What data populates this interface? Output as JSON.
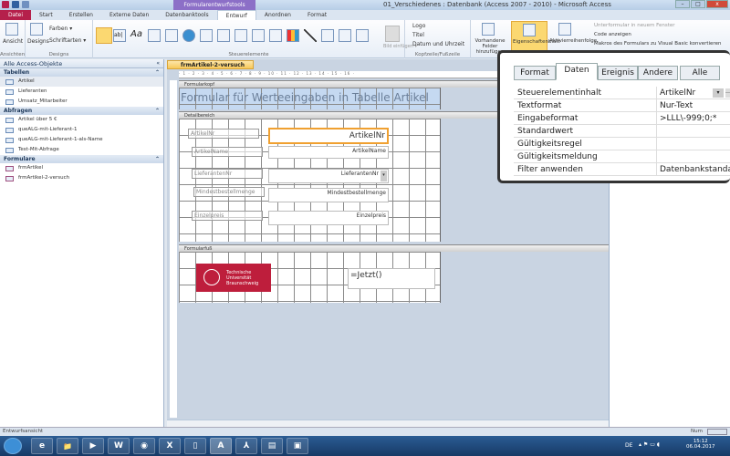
{
  "titlebar": {
    "title": "01_Verschiedenes : Datenbank (Access 2007 - 2010) - Microsoft Access",
    "context_tab": "Formularentwurfstools",
    "minimize": "–",
    "maximize": "□",
    "close": "x"
  },
  "tabs": [
    "Datei",
    "Start",
    "Erstellen",
    "Externe Daten",
    "Datenbanktools",
    "Entwurf",
    "Anordnen",
    "Format"
  ],
  "ribbon": {
    "ansichten": {
      "button": "Ansicht",
      "group": "Ansichten"
    },
    "designs": {
      "button": "Designs",
      "farben": "Farben ▾",
      "schriftarten": "Schriftarten ▾",
      "group": "Designs"
    },
    "steuerelemente": {
      "group": "Steuerelemente",
      "textbox": "ab|",
      "label": "Aa"
    },
    "bild": {
      "label": "Bild einfügen ▾"
    },
    "kopf": {
      "logo": "Logo",
      "titel": "Titel",
      "datum": "Datum und Uhrzeit",
      "group": "Kopfzeile/Fußzeile"
    },
    "tools": {
      "vorhandene": "Vorhandene Felder hinzufügen",
      "eigenschaften": "Eigenschaftenblatt",
      "aktivierung": "Aktivierreihenfolge",
      "unterformular": "Unterformular in neuem Fenster",
      "code": "Code anzeigen",
      "makros": "Makros des Formulars zu Visual Basic konvertieren"
    }
  },
  "nav": {
    "title": "Alle Access-Objekte",
    "sections": [
      {
        "name": "Tabellen",
        "items": [
          "Artikel",
          "Lieferanten",
          "Umsatz_Mitarbeiter"
        ]
      },
      {
        "name": "Abfragen",
        "items": [
          "Artikel über 5 €",
          "queALG-mit-Lieferant-1",
          "queALG-mit-Lieferant-1-als-Name",
          "Test-Mit-Abfrage"
        ]
      },
      {
        "name": "Formulare",
        "items": [
          "frmArtikel",
          "frmArtikel-2-versuch"
        ]
      }
    ]
  },
  "document": {
    "tab": "frmArtikel-2-versuch",
    "ruler": "· 1 · 2 · 3 · 4 · 5 · 6 · 7 · 8 · 9 · 10 · 11 · 12 · 13 · 14 · 15 · 16 ·",
    "header_section": "Formularkopf",
    "header_title": "Formular für Werteeingaben in Tabelle Artikel",
    "detail_section": "Detailbereich",
    "fields": [
      {
        "label": "ArtikelNr",
        "control": "ArtikelNr"
      },
      {
        "label": "ArtikelName",
        "control": "ArtikelName"
      },
      {
        "label": "LieferantenNr",
        "control": "LieferantenNr"
      },
      {
        "label": "Mindestbestellmenge",
        "control": "Mindestbestellmenge"
      },
      {
        "label": "Einzelpreis",
        "control": "Einzelpreis"
      }
    ],
    "footer_section": "Formularfuß",
    "logo_text": [
      "Technische",
      "Universität",
      "Braunschweig"
    ],
    "footer_control": "=Jetzt()"
  },
  "properties": {
    "tabs": [
      "Format",
      "Daten",
      "Ereignis",
      "Andere",
      "Alle"
    ],
    "active_tab": "Daten",
    "rows": [
      {
        "key": "Steuerelementinhalt",
        "value": "ArtikelNr"
      },
      {
        "key": "Textformat",
        "value": "Nur-Text"
      },
      {
        "key": "Eingabeformat",
        "value": ">LLL\\-999;0;*"
      },
      {
        "key": "Standardwert",
        "value": ""
      },
      {
        "key": "Gültigkeitsregel",
        "value": ""
      },
      {
        "key": "Gültigkeitsmeldung",
        "value": ""
      },
      {
        "key": "Filter anwenden",
        "value": "Datenbankstandard"
      }
    ]
  },
  "status": {
    "text": "Entwurfsansicht",
    "num": "Num"
  },
  "taskbar": {
    "apps": [
      "e",
      "📁",
      "▶",
      "W",
      "◉",
      "X",
      "▯",
      "A",
      "⅄",
      "▤",
      "▣"
    ],
    "lang": "DE",
    "time": "15:12",
    "date": "06.04.2017"
  },
  "colors": {
    "file_tab": "#b5204b",
    "context": "#8c6fc7",
    "header_band": "#c5d9f1",
    "tu_red": "#be1e3c",
    "selection": "#f0a030"
  }
}
